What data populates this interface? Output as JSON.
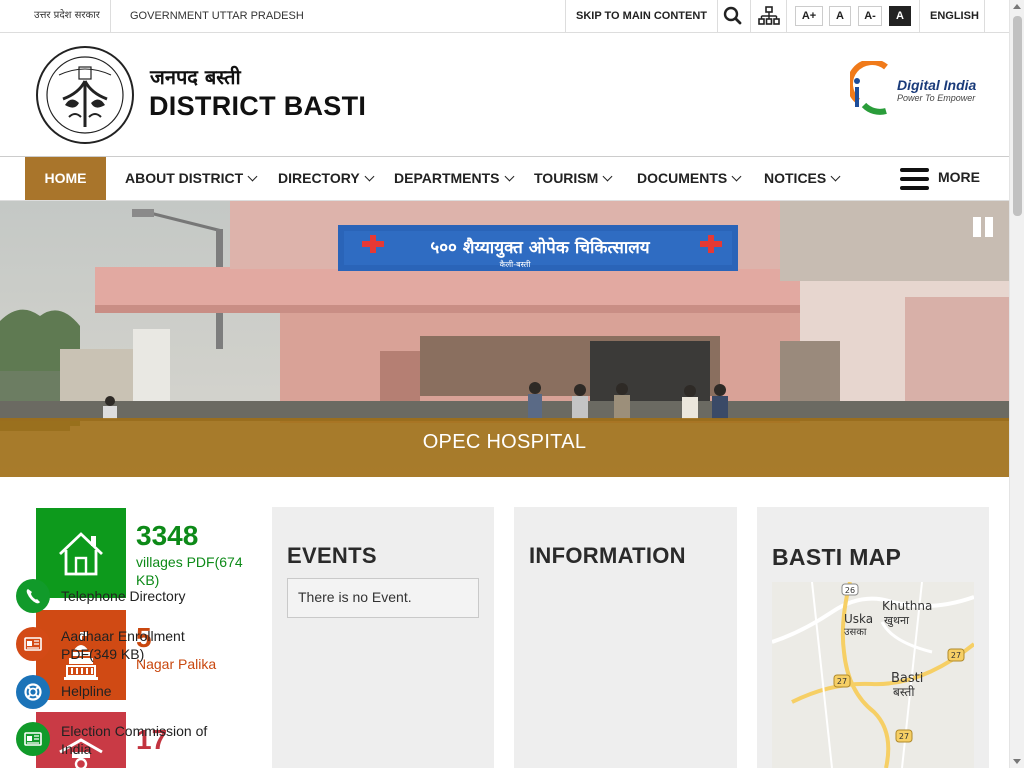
{
  "topbar": {
    "hindi_gov": "उत्तर प्रदेश सरकार",
    "gov_name": "GOVERNMENT UTTAR PRADESH",
    "skip_link": "SKIP TO MAIN CONTENT",
    "search_icon": "search-icon",
    "sitemap_icon": "sitemap-icon",
    "font_increase": "A+",
    "font_normal": "A",
    "font_decrease": "A-",
    "contrast": "A",
    "language": "ENGLISH"
  },
  "header": {
    "title_hindi": "जनपद बस्ती",
    "title_english": "DISTRICT BASTI",
    "partner_logo_title": "Digital India",
    "partner_logo_tagline": "Power To Empower"
  },
  "nav": {
    "items": [
      {
        "label": "HOME",
        "active": true
      },
      {
        "label": "ABOUT DISTRICT",
        "dropdown": true
      },
      {
        "label": "DIRECTORY",
        "dropdown": true
      },
      {
        "label": "DEPARTMENTS",
        "dropdown": true
      },
      {
        "label": "TOURISM",
        "dropdown": true
      },
      {
        "label": "DOCUMENTS",
        "dropdown": true
      },
      {
        "label": "NOTICES",
        "dropdown": true
      }
    ],
    "more_label": "MORE"
  },
  "banner": {
    "caption": "OPEC HOSPITAL",
    "sign_text": "५०० शैय्यायुक्त ओपेक चिकित्सालय",
    "sign_subtext": "कैली-बस्ती"
  },
  "stats": [
    {
      "number": "3348",
      "label": "villages PDF(674 KB)",
      "icon": "home-icon",
      "color": "#0d9a1c"
    },
    {
      "number": "5",
      "label": "Nagar Palika",
      "icon": "municipal-building-icon",
      "color": "#d04a14"
    },
    {
      "number": "17",
      "label": "",
      "icon": "school-icon",
      "color": "#c93a45"
    }
  ],
  "events": {
    "title": "EVENTS",
    "empty_message": "There is no Event."
  },
  "information": {
    "title": "INFORMATION",
    "items": [
      {
        "label": "Telephone Directory",
        "icon": "phone-icon"
      },
      {
        "label": "Aadhaar Enrollment PDF(349 KB)",
        "icon": "id-card-icon"
      },
      {
        "label": "Helpline",
        "icon": "lifebuoy-icon"
      },
      {
        "label": "Election Commission of India",
        "icon": "id-card-icon"
      }
    ]
  },
  "map": {
    "title": "BASTI MAP",
    "places": [
      {
        "name": "Khuthna",
        "name_hi": "खुथना"
      },
      {
        "name": "Uska",
        "name_hi": "उसका"
      },
      {
        "name": "Basti",
        "name_hi": "बस्ती"
      }
    ],
    "route_badges": [
      "26",
      "27",
      "27",
      "27"
    ]
  }
}
